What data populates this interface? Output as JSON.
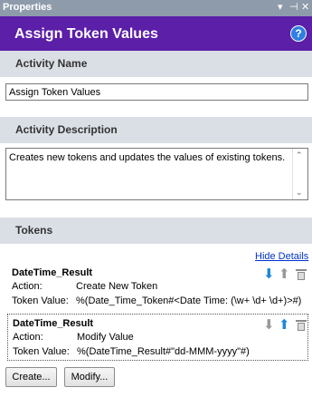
{
  "panel": {
    "title": "Properties",
    "pin_glyph": "▾ ⊣ ✕"
  },
  "header": {
    "title": "Assign Token Values",
    "help_glyph": "?"
  },
  "activity_name": {
    "heading": "Activity Name",
    "value": "Assign Token Values"
  },
  "activity_description": {
    "heading": "Activity Description",
    "value": "Creates new tokens and updates the values of existing tokens."
  },
  "tokens": {
    "heading": "Tokens",
    "hide_details": "Hide Details",
    "items": [
      {
        "name": "DateTime_Result",
        "action_label": "Action:",
        "action": "Create New Token",
        "value_label": "Token Value:",
        "value": "%(Date_Time_Token#<Date Time: (\\w+ \\d+ \\d+)>#)"
      },
      {
        "name": "DateTime_Result",
        "action_label": "Action:",
        "action": "Modify Value",
        "value_label": "Token Value:",
        "value": "%(DateTime_Result#\"dd-MMM-yyyy\"#)"
      }
    ]
  },
  "buttons": {
    "create": "Create...",
    "modify": "Modify..."
  }
}
